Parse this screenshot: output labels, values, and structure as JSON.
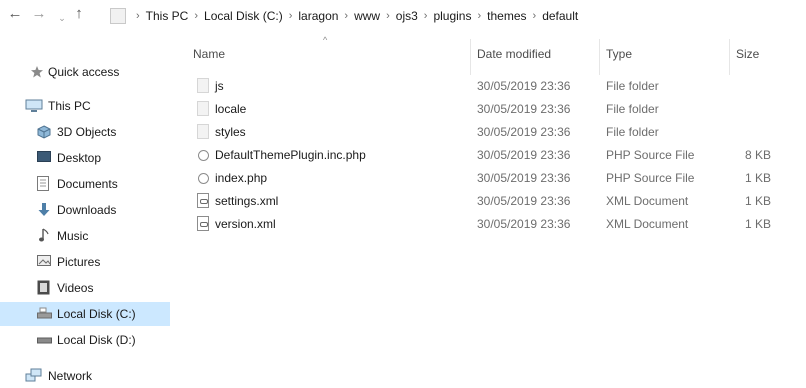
{
  "address": {
    "nav_back": "←",
    "nav_forward": "→",
    "nav_recent": "⌄",
    "nav_up": "↑",
    "separator": "›",
    "breadcrumbs": [
      "This PC",
      "Local Disk (C:)",
      "laragon",
      "www",
      "ojs3",
      "plugins",
      "themes",
      "default"
    ]
  },
  "sidebar": {
    "items": [
      {
        "label": "Quick access",
        "icon": "pin-icon"
      },
      {
        "label": "This PC",
        "icon": "monitor-icon"
      },
      {
        "label": "3D Objects",
        "icon": "3d-objects-icon"
      },
      {
        "label": "Desktop",
        "icon": "desktop-icon"
      },
      {
        "label": "Documents",
        "icon": "documents-icon"
      },
      {
        "label": "Downloads",
        "icon": "download-arrow-icon"
      },
      {
        "label": "Music",
        "icon": "music-note-icon"
      },
      {
        "label": "Pictures",
        "icon": "pictures-icon"
      },
      {
        "label": "Videos",
        "icon": "videos-icon"
      },
      {
        "label": "Local Disk (C:)",
        "icon": "drive-icon",
        "selected": true
      },
      {
        "label": "Local Disk (D:)",
        "icon": "drive-icon"
      },
      {
        "label": "Network",
        "icon": "network-icon"
      }
    ]
  },
  "columns": {
    "name": "Name",
    "date": "Date modified",
    "type": "Type",
    "size": "Size",
    "sort_indicator": "^"
  },
  "files": [
    {
      "name": "js",
      "date": "30/05/2019 23:36",
      "type": "File folder",
      "size": "",
      "icon": "folder-icon"
    },
    {
      "name": "locale",
      "date": "30/05/2019 23:36",
      "type": "File folder",
      "size": "",
      "icon": "folder-icon"
    },
    {
      "name": "styles",
      "date": "30/05/2019 23:36",
      "type": "File folder",
      "size": "",
      "icon": "folder-icon"
    },
    {
      "name": "DefaultThemePlugin.inc.php",
      "date": "30/05/2019 23:36",
      "type": "PHP Source File",
      "size": "8 KB",
      "icon": "php-file-icon"
    },
    {
      "name": "index.php",
      "date": "30/05/2019 23:36",
      "type": "PHP Source File",
      "size": "1 KB",
      "icon": "php-file-icon"
    },
    {
      "name": "settings.xml",
      "date": "30/05/2019 23:36",
      "type": "XML Document",
      "size": "1 KB",
      "icon": "xml-file-icon"
    },
    {
      "name": "version.xml",
      "date": "30/05/2019 23:36",
      "type": "XML Document",
      "size": "1 KB",
      "icon": "xml-file-icon"
    }
  ],
  "colors": {
    "selected_bg": "#cce8ff",
    "text": "#1a1a1a",
    "muted_text": "#6d6d6d"
  }
}
